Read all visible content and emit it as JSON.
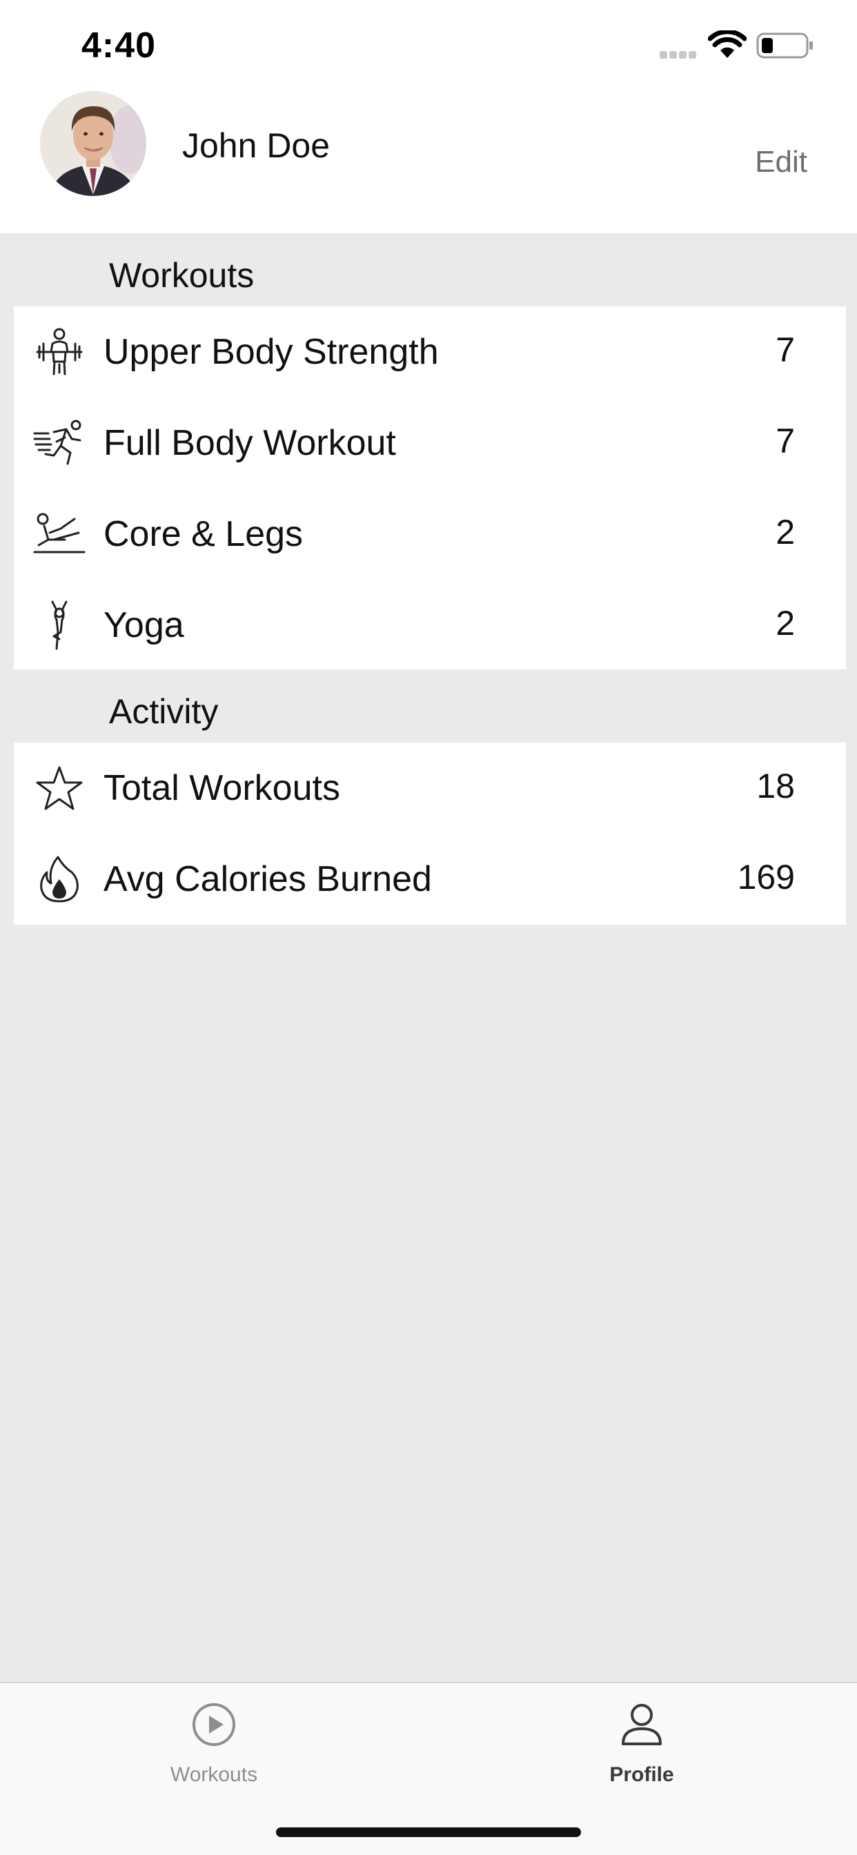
{
  "status_bar": {
    "time": "4:40"
  },
  "profile": {
    "name": "John Doe",
    "edit_label": "Edit"
  },
  "workouts_section": {
    "title": "Workouts",
    "items": [
      {
        "label": "Upper Body Strength",
        "value": "7",
        "icon": "weightlifting-icon"
      },
      {
        "label": "Full Body Workout",
        "value": "7",
        "icon": "running-icon"
      },
      {
        "label": "Core & Legs",
        "value": "2",
        "icon": "leg-raise-icon"
      },
      {
        "label": "Yoga",
        "value": "2",
        "icon": "yoga-pose-icon"
      }
    ]
  },
  "activity_section": {
    "title": "Activity",
    "items": [
      {
        "label": "Total Workouts",
        "value": "18",
        "icon": "star-icon"
      },
      {
        "label": "Avg Calories Burned",
        "value": "169",
        "icon": "flame-icon"
      }
    ]
  },
  "tab_bar": {
    "tabs": [
      {
        "label": "Workouts",
        "icon": "play-circle-icon",
        "active": false
      },
      {
        "label": "Profile",
        "icon": "person-icon",
        "active": true
      }
    ]
  },
  "colors": {
    "background": "#eaeaea",
    "card": "#ffffff",
    "text": "#111111",
    "edit": "#6e6e6e",
    "tab_inactive": "#8e8e8e",
    "tab_active": "#3a3a3a"
  }
}
